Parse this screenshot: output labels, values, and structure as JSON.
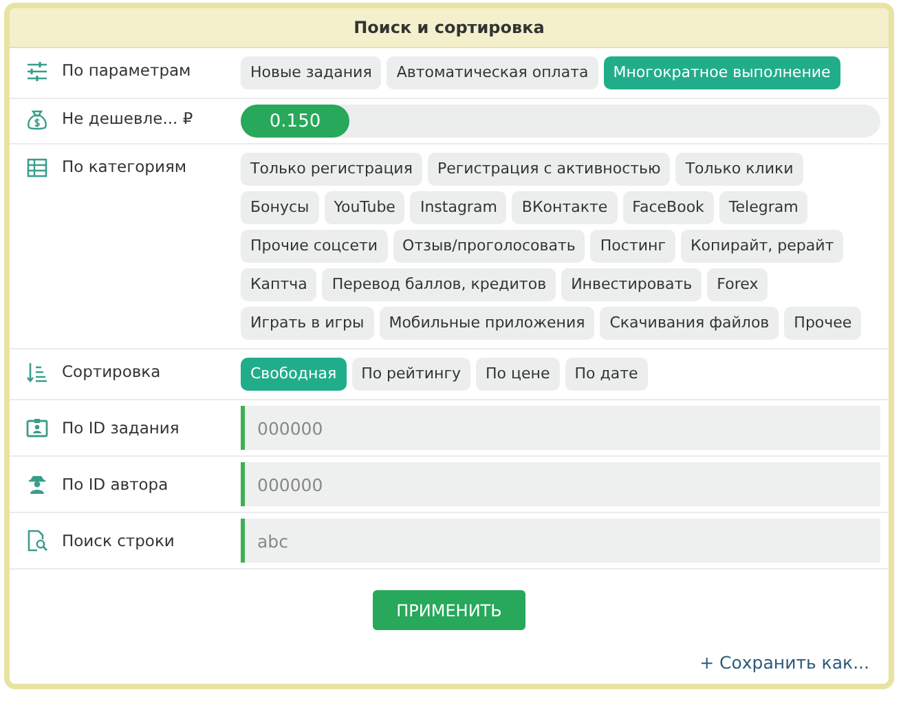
{
  "panel": {
    "title": "Поиск и сортировка"
  },
  "filters": [
    {
      "kind": "chips",
      "label": "По параметрам",
      "options": [
        {
          "label": "Новые задания",
          "selected": false
        },
        {
          "label": "Автоматическая оплата",
          "selected": false
        },
        {
          "label": "Многократное выполнение",
          "selected": true
        }
      ]
    },
    {
      "kind": "slider",
      "label": "Не дешевле... ₽",
      "value": "0.150",
      "level": 0.17
    },
    {
      "kind": "chips",
      "label": "По категориям",
      "options": [
        {
          "label": "Только регистрация",
          "selected": false
        },
        {
          "label": "Регистрация с активностью",
          "selected": false
        },
        {
          "label": "Только клики",
          "selected": false
        },
        {
          "label": "Бонусы",
          "selected": false
        },
        {
          "label": "YouTube",
          "selected": false
        },
        {
          "label": "Instagram",
          "selected": false
        },
        {
          "label": "ВКонтакте",
          "selected": false
        },
        {
          "label": "FaceBook",
          "selected": false
        },
        {
          "label": "Telegram",
          "selected": false
        },
        {
          "label": "Прочие соцсети",
          "selected": false
        },
        {
          "label": "Отзыв/проголосовать",
          "selected": false
        },
        {
          "label": "Постинг",
          "selected": false
        },
        {
          "label": "Копирайт, рерайт",
          "selected": false
        },
        {
          "label": "Каптча",
          "selected": false
        },
        {
          "label": "Перевод баллов, кредитов",
          "selected": false
        },
        {
          "label": "Инвестировать",
          "selected": false
        },
        {
          "label": "Forex",
          "selected": false
        },
        {
          "label": "Играть в игры",
          "selected": false
        },
        {
          "label": "Мобильные приложения",
          "selected": false
        },
        {
          "label": "Скачивания файлов",
          "selected": false
        },
        {
          "label": "Прочее",
          "selected": false
        }
      ]
    },
    {
      "kind": "chips",
      "label": "Сортировка",
      "options": [
        {
          "label": "Свободная",
          "selected": true
        },
        {
          "label": "По рейтингу",
          "selected": false
        },
        {
          "label": "По цене",
          "selected": false
        },
        {
          "label": "По дате",
          "selected": false
        }
      ]
    },
    {
      "kind": "field",
      "label": "По ID задания",
      "placeholder": "000000"
    },
    {
      "kind": "field",
      "label": "По ID автора",
      "placeholder": "000000"
    },
    {
      "kind": "field",
      "label": "Поиск строки",
      "placeholder": "abc"
    }
  ],
  "apply_button": "ПРИМЕНИТЬ",
  "save_link": "+ Сохранить как..."
}
